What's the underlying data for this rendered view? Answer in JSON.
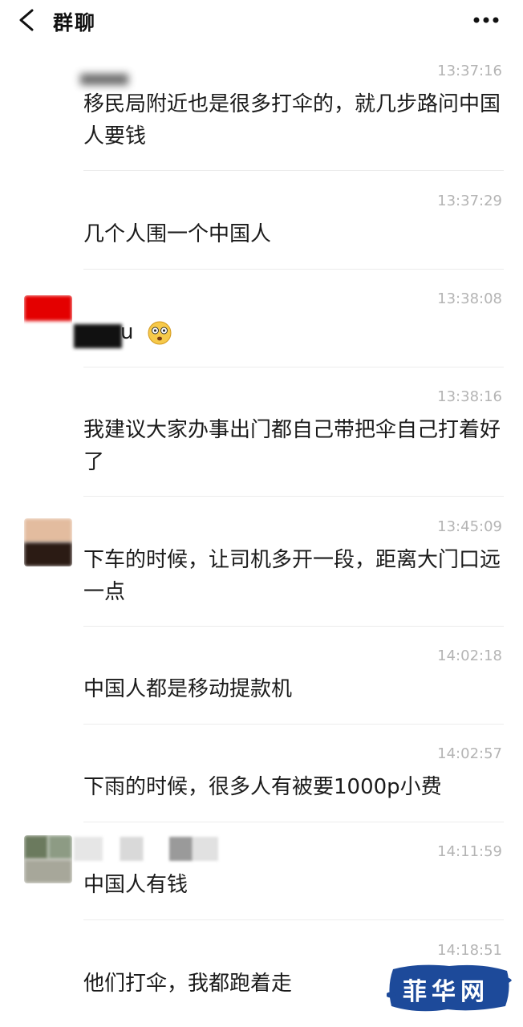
{
  "header": {
    "title": "群聊",
    "back_icon": "chevron-left-icon",
    "more_icon": "more-dots-icon"
  },
  "messages": [
    {
      "time": "13:37:16",
      "text": "移民局附近也是很多打伞的，就几步路问中国人要钱"
    },
    {
      "time": "13:37:29",
      "text": "几个人围一个中国人"
    },
    {
      "time": "13:38:08",
      "text": "u",
      "emoji": "dizzy-face-emoji"
    },
    {
      "time": "13:38:16",
      "text": "我建议大家办事出门都自己带把伞自己打着好了"
    },
    {
      "time": "13:45:09",
      "text": "下车的时候，让司机多开一段，距离大门口远一点"
    },
    {
      "time": "14:02:18",
      "text": "中国人都是移动提款机"
    },
    {
      "time": "14:02:57",
      "text": "下雨的时候，很多人有被要1000p小费"
    },
    {
      "time": "14:11:59",
      "text": "中国人有钱"
    },
    {
      "time": "14:18:51",
      "text": "他们打伞，我都跑着走"
    }
  ],
  "watermark": {
    "text": "菲华网"
  },
  "colors": {
    "timestamp": "#b4b4b4",
    "divider": "#ececec",
    "watermark_bg": "#1d4a9a"
  }
}
